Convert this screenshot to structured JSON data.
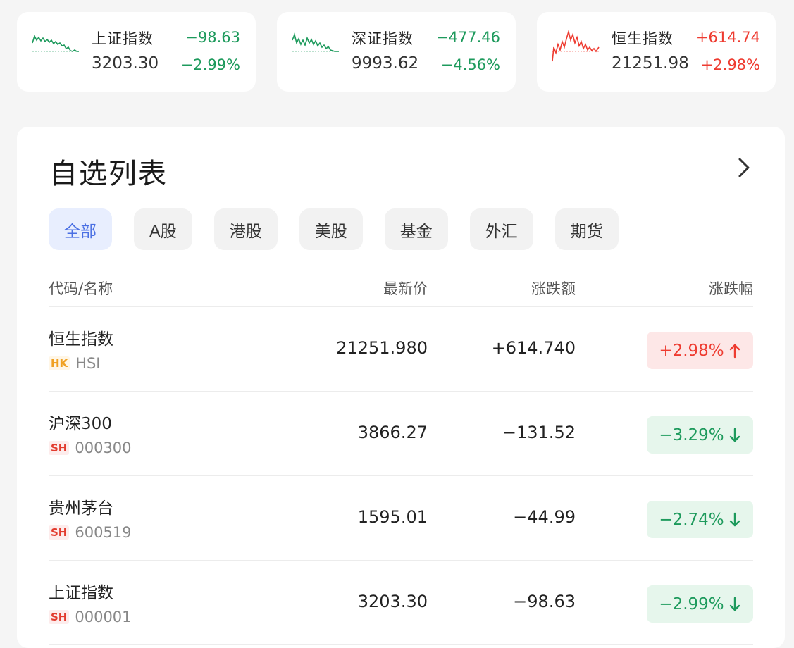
{
  "indices": [
    {
      "name": "上证指数",
      "price": "3203.30",
      "change": "−98.63",
      "pct": "−2.99%",
      "trend": "down",
      "color": "#1d9a5c"
    },
    {
      "name": "深证指数",
      "price": "9993.62",
      "change": "−477.46",
      "pct": "−4.56%",
      "trend": "down",
      "color": "#1d9a5c"
    },
    {
      "name": "恒生指数",
      "price": "21251.98",
      "change": "+614.74",
      "pct": "+2.98%",
      "trend": "up",
      "color": "#ee3b30"
    }
  ],
  "watchlist": {
    "title": "自选列表",
    "tabs": [
      "全部",
      "A股",
      "港股",
      "美股",
      "基金",
      "外汇",
      "期货"
    ],
    "active_tab": "全部",
    "columns": {
      "name": "代码/名称",
      "price": "最新价",
      "change": "涨跌额",
      "pct": "涨跌幅"
    },
    "rows": [
      {
        "name": "恒生指数",
        "market": "HK",
        "code": "HSI",
        "price": "21251.980",
        "change": "+614.740",
        "pct": "+2.98%",
        "trend": "up"
      },
      {
        "name": "沪深300",
        "market": "SH",
        "code": "000300",
        "price": "3866.27",
        "change": "−131.52",
        "pct": "−3.29%",
        "trend": "down"
      },
      {
        "name": "贵州茅台",
        "market": "SH",
        "code": "600519",
        "price": "1595.01",
        "change": "−44.99",
        "pct": "−2.74%",
        "trend": "down"
      },
      {
        "name": "上证指数",
        "market": "SH",
        "code": "000001",
        "price": "3203.30",
        "change": "−98.63",
        "pct": "−2.99%",
        "trend": "down"
      }
    ]
  },
  "icons": {
    "more": "chevron-right-icon",
    "up": "arrow-up-icon",
    "down": "arrow-down-icon",
    "sparkline": "sparkline-icon"
  },
  "colors": {
    "up": "#ee3b30",
    "down": "#1d9a5c",
    "accent": "#4a6fe3"
  }
}
